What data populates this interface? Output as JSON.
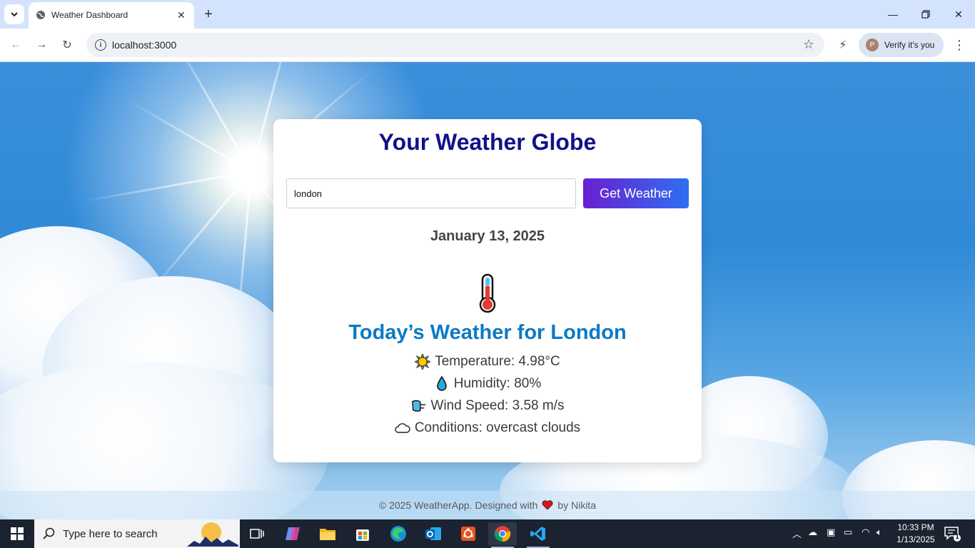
{
  "browser": {
    "tab_title": "Weather Dashboard",
    "url": "localhost:3000",
    "profile_label": "Verify it's you",
    "profile_initial": "P"
  },
  "app": {
    "title": "Your Weather Globe",
    "search": {
      "value": "london",
      "placeholder": ""
    },
    "button_label": "Get Weather",
    "date": "January 13, 2025",
    "heading": "Today’s Weather for London",
    "stats": [
      {
        "icon": "sun-icon",
        "text": "Temperature: 4.98°C"
      },
      {
        "icon": "droplet-icon",
        "text": "Humidity: 80%"
      },
      {
        "icon": "wind-icon",
        "text": "Wind Speed: 3.58 m/s"
      },
      {
        "icon": "cloud-icon",
        "text": "Conditions: overcast clouds"
      }
    ],
    "footer": {
      "prefix": "© 2025 WeatherApp. Designed with",
      "suffix": "by Nikita"
    }
  },
  "taskbar": {
    "search_placeholder": "Type here to search",
    "time": "10:33 PM",
    "date": "1/13/2025",
    "notification_count": "1"
  },
  "colors": {
    "title": "#11118a",
    "heading": "#0c7ac4",
    "button_from": "#6a1fd1",
    "button_to": "#2f6ff0"
  }
}
